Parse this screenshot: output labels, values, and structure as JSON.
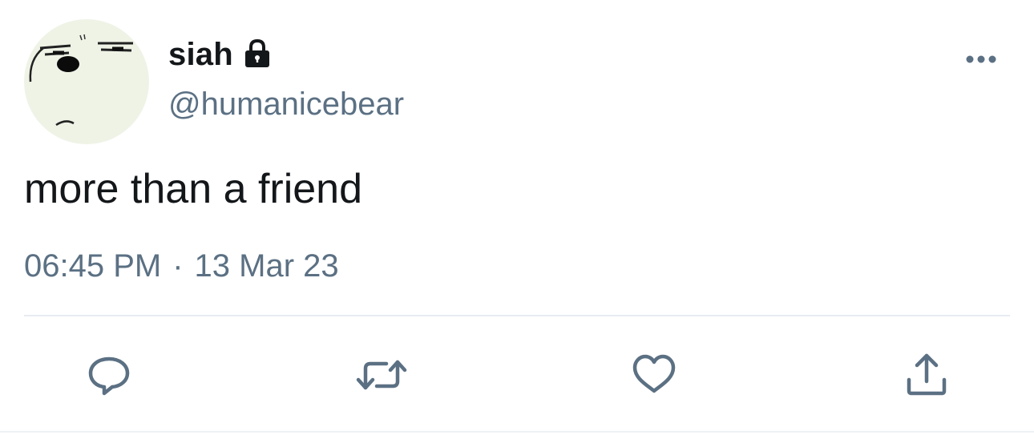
{
  "tweet": {
    "display_name": "siah",
    "handle": "@humanicebear",
    "text": "more than a friend",
    "time": "06:45 PM",
    "separator": "·",
    "date": "13 Mar 23"
  },
  "icons": {
    "avatar": "ice-bear-face-avatar",
    "protected": "lock-icon",
    "more": "more-options-icon",
    "reply": "reply-icon",
    "retweet": "retweet-icon",
    "like": "heart-icon",
    "share": "share-icon"
  },
  "colors": {
    "text_primary": "#14171a",
    "text_secondary": "#5b7083",
    "divider": "#e6ecf0",
    "avatar_bg": "#eef3e6"
  }
}
